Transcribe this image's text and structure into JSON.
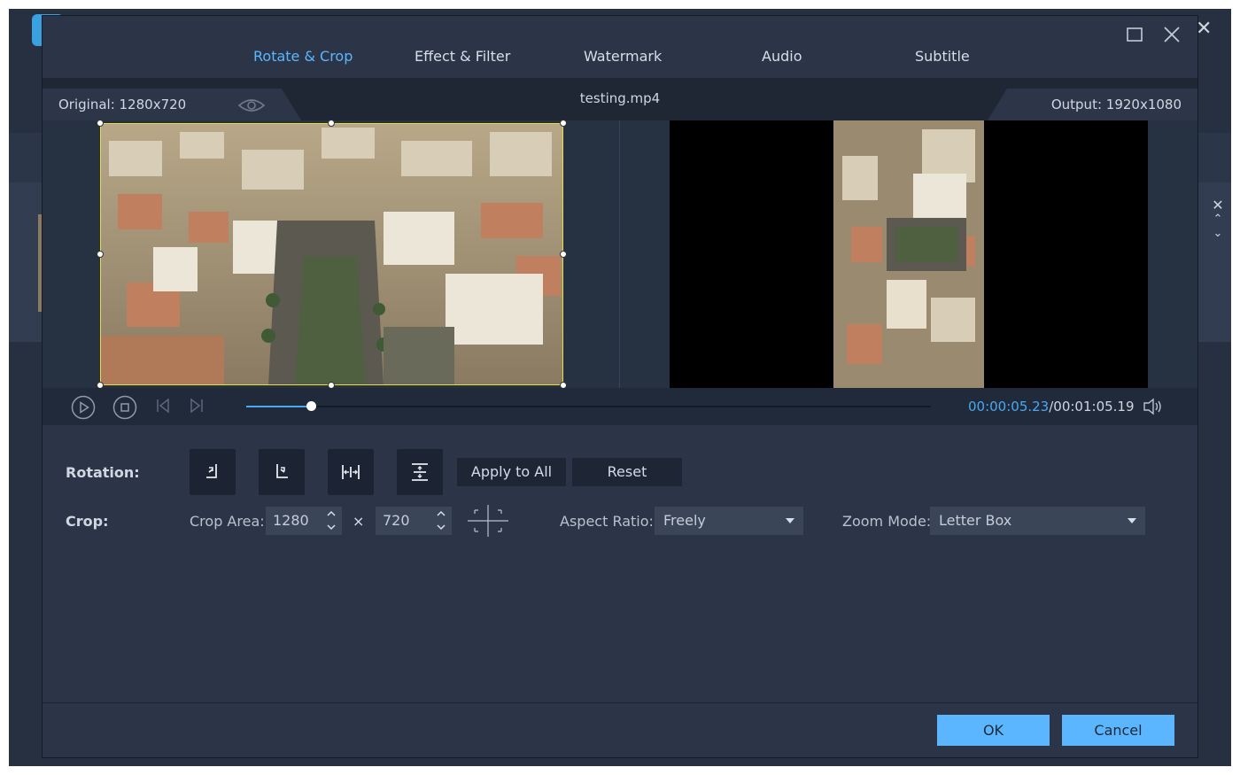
{
  "tabs": [
    {
      "label": "Rotate & Crop",
      "active": true
    },
    {
      "label": "Effect & Filter",
      "active": false
    },
    {
      "label": "Watermark",
      "active": false
    },
    {
      "label": "Audio",
      "active": false
    },
    {
      "label": "Subtitle",
      "active": false
    }
  ],
  "header": {
    "original": "Original: 1280x720",
    "filename": "testing.mp4",
    "output": "Output: 1920x1080"
  },
  "player": {
    "current_time": "00:00:05.23",
    "total_time": "/00:01:05.19",
    "progress": 0.094
  },
  "rotation": {
    "label": "Rotation:",
    "apply_all": "Apply to All",
    "reset": "Reset"
  },
  "crop": {
    "label": "Crop:",
    "area_label": "Crop Area:",
    "width": "1280",
    "times": "×",
    "height": "720",
    "aspect_label": "Aspect Ratio:",
    "aspect_value": "Freely",
    "zoom_label": "Zoom Mode:",
    "zoom_value": "Letter Box"
  },
  "footer": {
    "ok": "OK",
    "cancel": "Cancel"
  },
  "colors": {
    "accent": "#5cb6ff",
    "crop_frame": "#e8e040",
    "background": "#2b3547"
  }
}
